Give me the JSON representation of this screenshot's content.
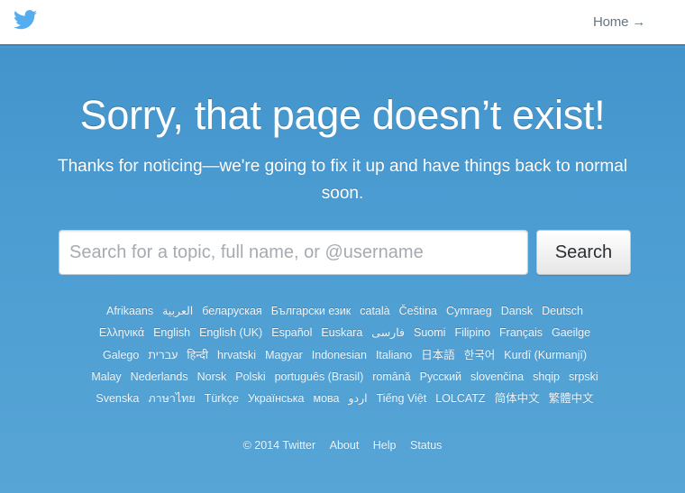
{
  "header": {
    "logo_icon": "twitter-bird-icon",
    "home_link": "Home →"
  },
  "colors": {
    "brand_blue": "#55acee",
    "background": "#4a9ad0"
  },
  "main": {
    "title": "Sorry, that page doesn’t exist!",
    "subtitle": "Thanks for noticing—we're going to fix it up and have things back to normal soon."
  },
  "search": {
    "placeholder": "Search for a topic, full name, or @username",
    "value": "",
    "button_label": "Search"
  },
  "languages": [
    "Afrikaans",
    "العربية",
    "беларуская",
    "Български език",
    "català",
    "Čeština",
    "Cymraeg",
    "Dansk",
    "Deutsch",
    "Ελληνικά",
    "English",
    "English (UK)",
    "Español",
    "Euskara",
    "فارسی",
    "Suomi",
    "Filipino",
    "Français",
    "Gaeilge",
    "Galego",
    "עברית",
    "हिन्दी",
    "hrvatski",
    "Magyar",
    "Indonesian",
    "Italiano",
    "日本語",
    "한국어",
    "Kurdî (Kurmanjî)",
    "Malay",
    "Nederlands",
    "Norsk",
    "Polski",
    "português (Brasil)",
    "română",
    "Русский",
    "slovenčina",
    "shqip",
    "srpski",
    "Svenska",
    "ภาษาไทย",
    "Türkçe",
    "Українська",
    "мова",
    "اردو",
    "Tiếng Việt",
    "LOLCATZ",
    "简体中文",
    "繁體中文"
  ],
  "footer": {
    "copyright": "© 2014 Twitter",
    "links": [
      "About",
      "Help",
      "Status"
    ]
  }
}
